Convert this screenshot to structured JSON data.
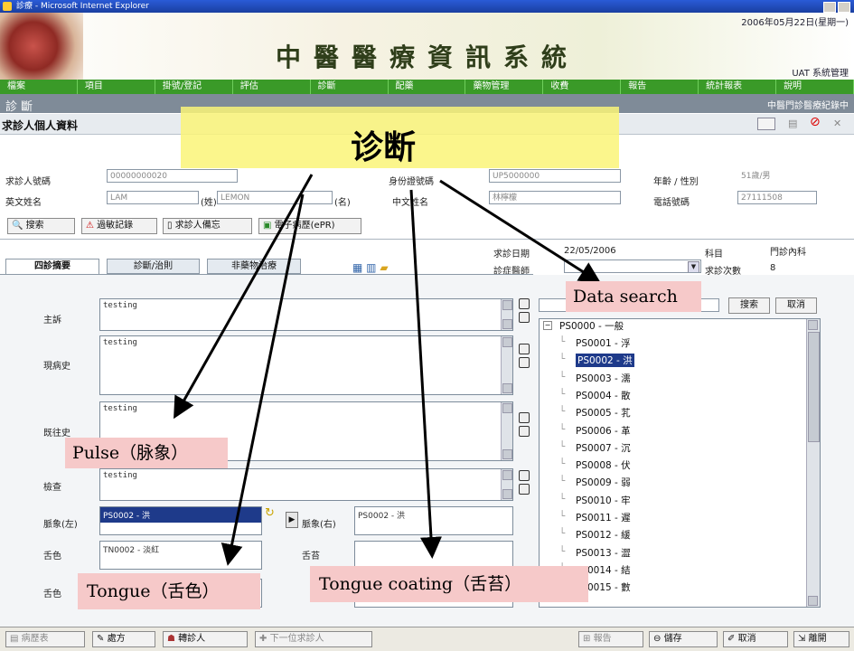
{
  "window": {
    "title": "診療 - Microsoft Internet Explorer"
  },
  "banner": {
    "system_name": "中醫醫療資訊系統",
    "date": "2006年05月22日(星期一)",
    "user": "UAT 系統管理"
  },
  "menu": [
    "檔案",
    "項目",
    "掛號/登記",
    "評估",
    "診斷",
    "配藥",
    "藥物管理",
    "收費",
    "報告",
    "統計報表",
    "說明"
  ],
  "section": {
    "left": "診 斷",
    "right": "中醫門診醫療紀錄中"
  },
  "patient_header": {
    "title": "求診人個人資料"
  },
  "patient": {
    "id_label": "求診人號碼",
    "id_value": "00000000020",
    "idcard_label": "身份證號碼",
    "idcard_value": "UP5000000",
    "age_sex_label": "年齡 / 性別",
    "age_sex_value": "51歲/男",
    "en_name_label": "英文姓名",
    "surname": "LAM",
    "given_label": "(姓)",
    "given": "LEMON",
    "name_suffix": "(名)",
    "cn_name_label": "中文姓名",
    "cn_name_value": "林檸檬",
    "phone_label": "電話號碼",
    "phone_value": "27111508"
  },
  "patient_buttons": {
    "search": "搜索",
    "allergy": "過敏記錄",
    "other": "求診人備忘",
    "ehr": "電子病歷(ePR)"
  },
  "visit": {
    "date_label": "求診日期",
    "date_value": "22/05/2006",
    "dept_label": "科目",
    "dept_value": "門診內科",
    "doctor_label": "診症醫師",
    "count_label": "求診次數",
    "count_value": "8"
  },
  "tabs": [
    "四診摘要",
    "診斷/治則",
    "非藥物治療"
  ],
  "fields": {
    "chief": {
      "label": "主訴",
      "value": "testing"
    },
    "present": {
      "label": "現病史",
      "value": "testing"
    },
    "past": {
      "label": "既往史",
      "value": "testing"
    },
    "exam": {
      "label": "檢查",
      "value": "testing"
    },
    "pulse_left": {
      "label": "脈象(左)",
      "value": "PS0002 - 洪"
    },
    "pulse_right": {
      "label": "脈象(右)",
      "value": "PS0002 - 洪"
    },
    "tongue_color": {
      "label": "舌色",
      "value": "TN0002 - 淡紅"
    },
    "tongue_coating": {
      "label": "舌苔",
      "value": ""
    },
    "tongue_shape": {
      "label": "舌色"
    }
  },
  "search_panel": {
    "search_btn": "搜索",
    "cancel_btn": "取消"
  },
  "tree": {
    "root": "PS0000 - 一般",
    "items": [
      "PS0001 - 浮",
      "PS0002 - 洪",
      "PS0003 - 濡",
      "PS0004 - 散",
      "PS0005 - 芤",
      "PS0006 - 革",
      "PS0007 - 沉",
      "PS0008 - 伏",
      "PS0009 - 弱",
      "PS0010 - 牢",
      "PS0011 - 遲",
      "PS0012 - 緩",
      "PS0013 - 澀",
      "PS0014 - 結",
      "PS0015 - 數"
    ],
    "selected_index": 1
  },
  "bottom_buttons": [
    "病歷表",
    "處方",
    "轉診人",
    "下一位求診人",
    "報告",
    "儲存",
    "取消",
    "離開"
  ],
  "annotations": {
    "diagnosis": "诊断",
    "data_search": "Data search",
    "pulse": "Pulse（脉象）",
    "tongue": "Tongue（舌色）",
    "tongue_coating": "Tongue coating（舌苔）"
  }
}
